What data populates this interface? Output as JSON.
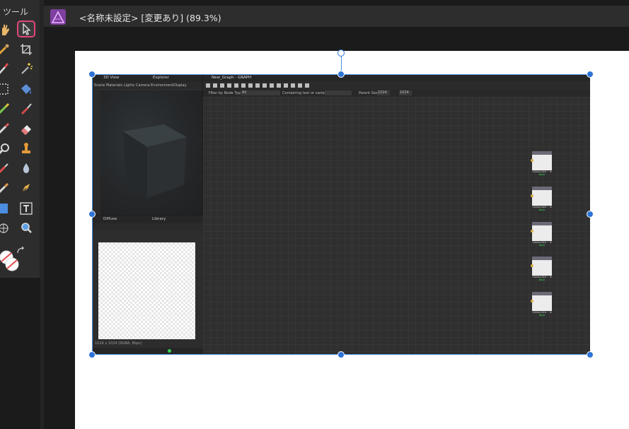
{
  "toolbar": {
    "title": "ツール",
    "tools": [
      {
        "icon": "hand-icon"
      },
      {
        "icon": "move-pointer-icon",
        "active": true
      },
      {
        "icon": "pipette-icon"
      },
      {
        "icon": "crop-icon"
      },
      {
        "icon": "brush-icon"
      },
      {
        "icon": "magic-wand-icon"
      },
      {
        "icon": "marquee-select-icon"
      },
      {
        "icon": "fill-bucket-icon"
      },
      {
        "icon": "paint-brush-icon"
      },
      {
        "icon": "brush-alt-icon"
      },
      {
        "icon": "eraser-icon"
      },
      {
        "icon": "dodge-icon"
      },
      {
        "icon": "clone-stamp-icon"
      },
      {
        "icon": "smudge-icon"
      },
      {
        "icon": "blur-drop-icon"
      },
      {
        "icon": "pencil-icon"
      },
      {
        "icon": "pen-nib-icon"
      },
      {
        "icon": "rectangle-shape-icon"
      },
      {
        "icon": "text-tool-icon"
      },
      {
        "icon": "mesh-warp-icon"
      },
      {
        "icon": "zoom-icon"
      },
      {
        "icon": "color-swatches-icon"
      },
      {
        "icon": "swap-colors-icon"
      }
    ]
  },
  "window": {
    "title": "<名称未設定> [変更あり] (89.3%)"
  },
  "embedded": {
    "view3d": {
      "tabs": [
        "3D View",
        "Explorer"
      ],
      "menu": [
        "Scene",
        "Materials",
        "Lights",
        "Camera",
        "Environment",
        "Display"
      ]
    },
    "graph": {
      "title": "New_Graph - GRAPH",
      "filter_label": "Filter by Node Type",
      "filter_value": "All",
      "containing_label": "Containing text or variable",
      "parent_size_label": "Parent Size",
      "parent_size_value": "1024",
      "size_value": "1024",
      "nodes": [
        {
          "header": "Diffuse",
          "size": "1024x1024 ~ 8",
          "status": "Base"
        },
        {
          "header": "Normal",
          "size": "1024x1024 ~ 8",
          "status": "Base"
        },
        {
          "header": "Specular",
          "size": "1024x1024 ~ 8",
          "status": "Base"
        },
        {
          "header": "Metallic",
          "size": "1024x1024 ~ 8",
          "status": "Base"
        },
        {
          "header": "Height",
          "size": "1024x1024 ~ 8",
          "status": "Base"
        }
      ]
    },
    "view2d": {
      "tabs": [
        "Diffuse",
        "Library"
      ],
      "info": "1024 x 1024 (RGBA, 8bpc)"
    }
  },
  "colors": {
    "accent_selection": "#2e73d6",
    "active_tool_border": "#e2467a"
  }
}
